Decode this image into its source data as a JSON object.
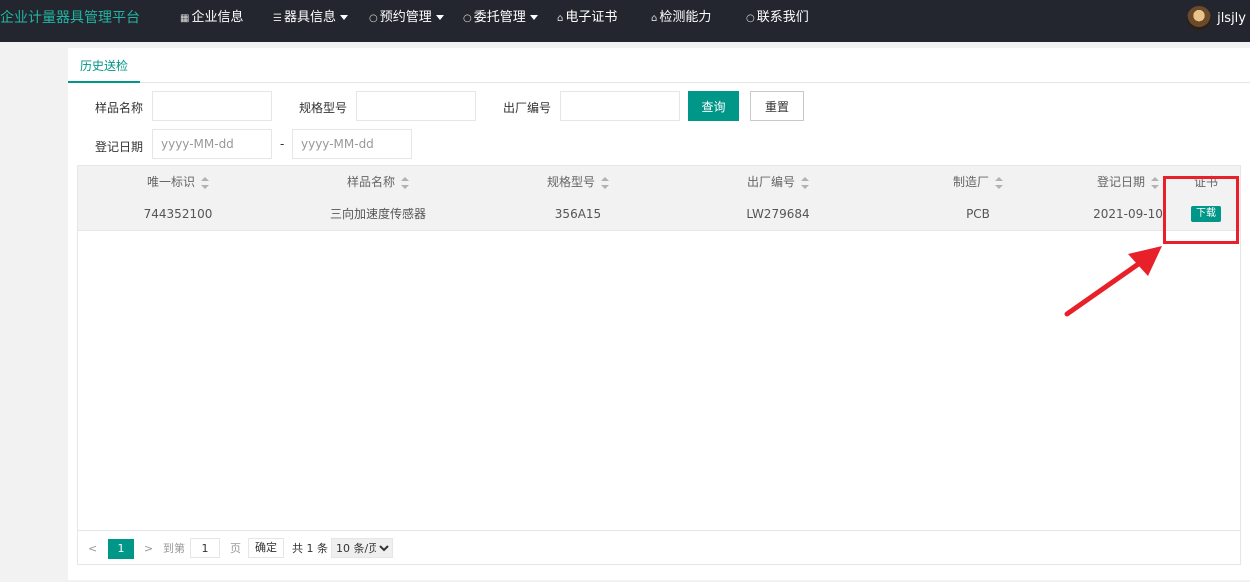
{
  "header": {
    "brand": "企业计量器具管理平台",
    "nav": [
      {
        "label": "企业信息",
        "icon": "building-icon",
        "glyph": "▦",
        "dropdown": false
      },
      {
        "label": "器具信息",
        "icon": "layers-icon",
        "glyph": "☰",
        "dropdown": true
      },
      {
        "label": "预约管理",
        "icon": "clock-icon",
        "glyph": "○",
        "dropdown": true
      },
      {
        "label": "委托管理",
        "icon": "clock-icon",
        "glyph": "○",
        "dropdown": true
      },
      {
        "label": "电子证书",
        "icon": "home-icon",
        "glyph": "⌂",
        "dropdown": false
      },
      {
        "label": "检测能力",
        "icon": "home-icon",
        "glyph": "⌂",
        "dropdown": false
      },
      {
        "label": "联系我们",
        "icon": "circle-icon",
        "glyph": "○",
        "dropdown": false
      }
    ],
    "user": "jlsjly"
  },
  "tabs": {
    "active": "历史送检"
  },
  "search": {
    "sample_name_label": "样品名称",
    "model_label": "规格型号",
    "serial_label": "出厂编号",
    "query_button": "查询",
    "reset_button": "重置",
    "date_label": "登记日期",
    "date_start_placeholder": "yyyy-MM-dd",
    "date_separator": "-",
    "date_end_placeholder": "yyyy-MM-dd"
  },
  "table": {
    "columns": [
      "唯一标识",
      "样品名称",
      "规格型号",
      "出厂编号",
      "制造厂",
      "登记日期",
      "证书"
    ],
    "rows": [
      {
        "id": "744352100",
        "name": "三向加速度传感器",
        "model": "356A15",
        "serial": "LW279684",
        "maker": "PCB",
        "date": "2021-09-10",
        "cert_action": "下载"
      }
    ]
  },
  "pagination": {
    "current": "1",
    "goto_label": "到第",
    "goto_value": "1",
    "page_unit": "页",
    "confirm": "确定",
    "total": "共 1 条",
    "page_size": "10 条/页"
  },
  "colors": {
    "accent": "#009688",
    "nav_bg": "#23262e",
    "brand": "#22b5a3",
    "annotation": "#e8202a"
  }
}
